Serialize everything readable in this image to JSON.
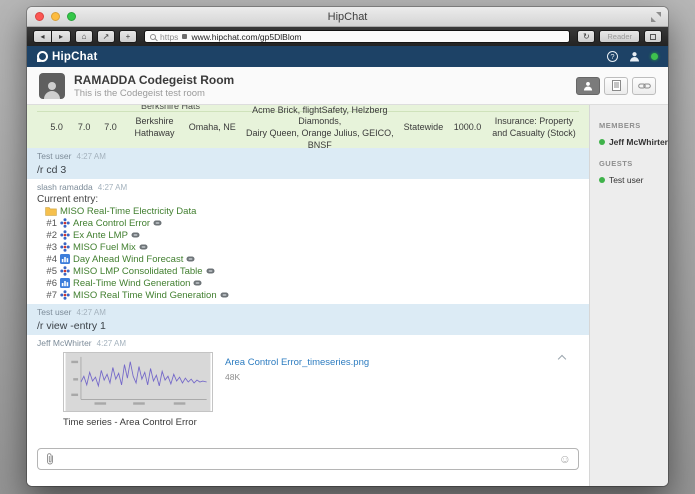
{
  "chrome": {
    "window_title": "HipChat",
    "url_scheme": "https",
    "url": "www.hipchat.com/gp5DlBlom",
    "reader_label": "Reader"
  },
  "navbar": {
    "brand": "HipChat"
  },
  "room": {
    "title": "RAMADDA Codegeist Room",
    "subtitle": "This is the Codegeist test room"
  },
  "table_message": {
    "partial_text": "Berkshire Hats",
    "cells": [
      "5.0",
      "7.0",
      "7.0",
      "Berkshire\nHathaway",
      "Omaha, NE",
      "Acme Brick, flightSafety, Helzberg Diamonds,\nDairy Queen, Orange Julius, GEICO, BNSF",
      "Statewide",
      "1000.0",
      "Insurance: Property\nand Casualty (Stock)"
    ]
  },
  "messages": {
    "cmd1": {
      "author": "Test user",
      "time": "4:27 AM",
      "text": "/r cd 3"
    },
    "ramadda": {
      "author": "slash ramadda",
      "time": "4:27 AM",
      "intro": "Current entry:",
      "folder_label": "MISO Real-Time Electricity Data",
      "entries": [
        {
          "num": "#1",
          "label": "Area Control Error",
          "icon": "point-data-icon"
        },
        {
          "num": "#2",
          "label": "Ex Ante LMP",
          "icon": "point-data-icon"
        },
        {
          "num": "#3",
          "label": "MISO Fuel Mix",
          "icon": "point-data-icon"
        },
        {
          "num": "#4",
          "label": "Day Ahead Wind Forecast",
          "icon": "chart-icon"
        },
        {
          "num": "#5",
          "label": "MISO LMP Consolidated Table",
          "icon": "point-data-icon"
        },
        {
          "num": "#6",
          "label": "Real-Time Wind Generation",
          "icon": "chart-icon"
        },
        {
          "num": "#7",
          "label": "MISO Real Time Wind Generation",
          "icon": "point-data-icon"
        }
      ]
    },
    "cmd2": {
      "author": "Test user",
      "time": "4:27 AM",
      "text": "/r view -entry 1"
    },
    "upload": {
      "author": "Jeff McWhirter",
      "time": "4:27 AM",
      "file_name": "Area Control Error_timeseries.png",
      "file_size": "48K",
      "caption": "Time series - Area Control Error"
    }
  },
  "sidebar": {
    "members_header": "MEMBERS",
    "members": [
      {
        "name": "Jeff McWhirter",
        "status": "online"
      }
    ],
    "guests_header": "GUESTS",
    "guests": [
      {
        "name": "Test user",
        "status": "online"
      }
    ]
  },
  "composer": {
    "value": ""
  },
  "colors": {
    "navbar_bg": "#1d4266",
    "presence_online": "#3ec14e",
    "green_message_bg": "#e7f3da",
    "blue_message_bg": "#dcebf5",
    "entry_link": "#417f2f",
    "file_link": "#2d7cc0",
    "thumbnail_line": "#7468c9"
  }
}
